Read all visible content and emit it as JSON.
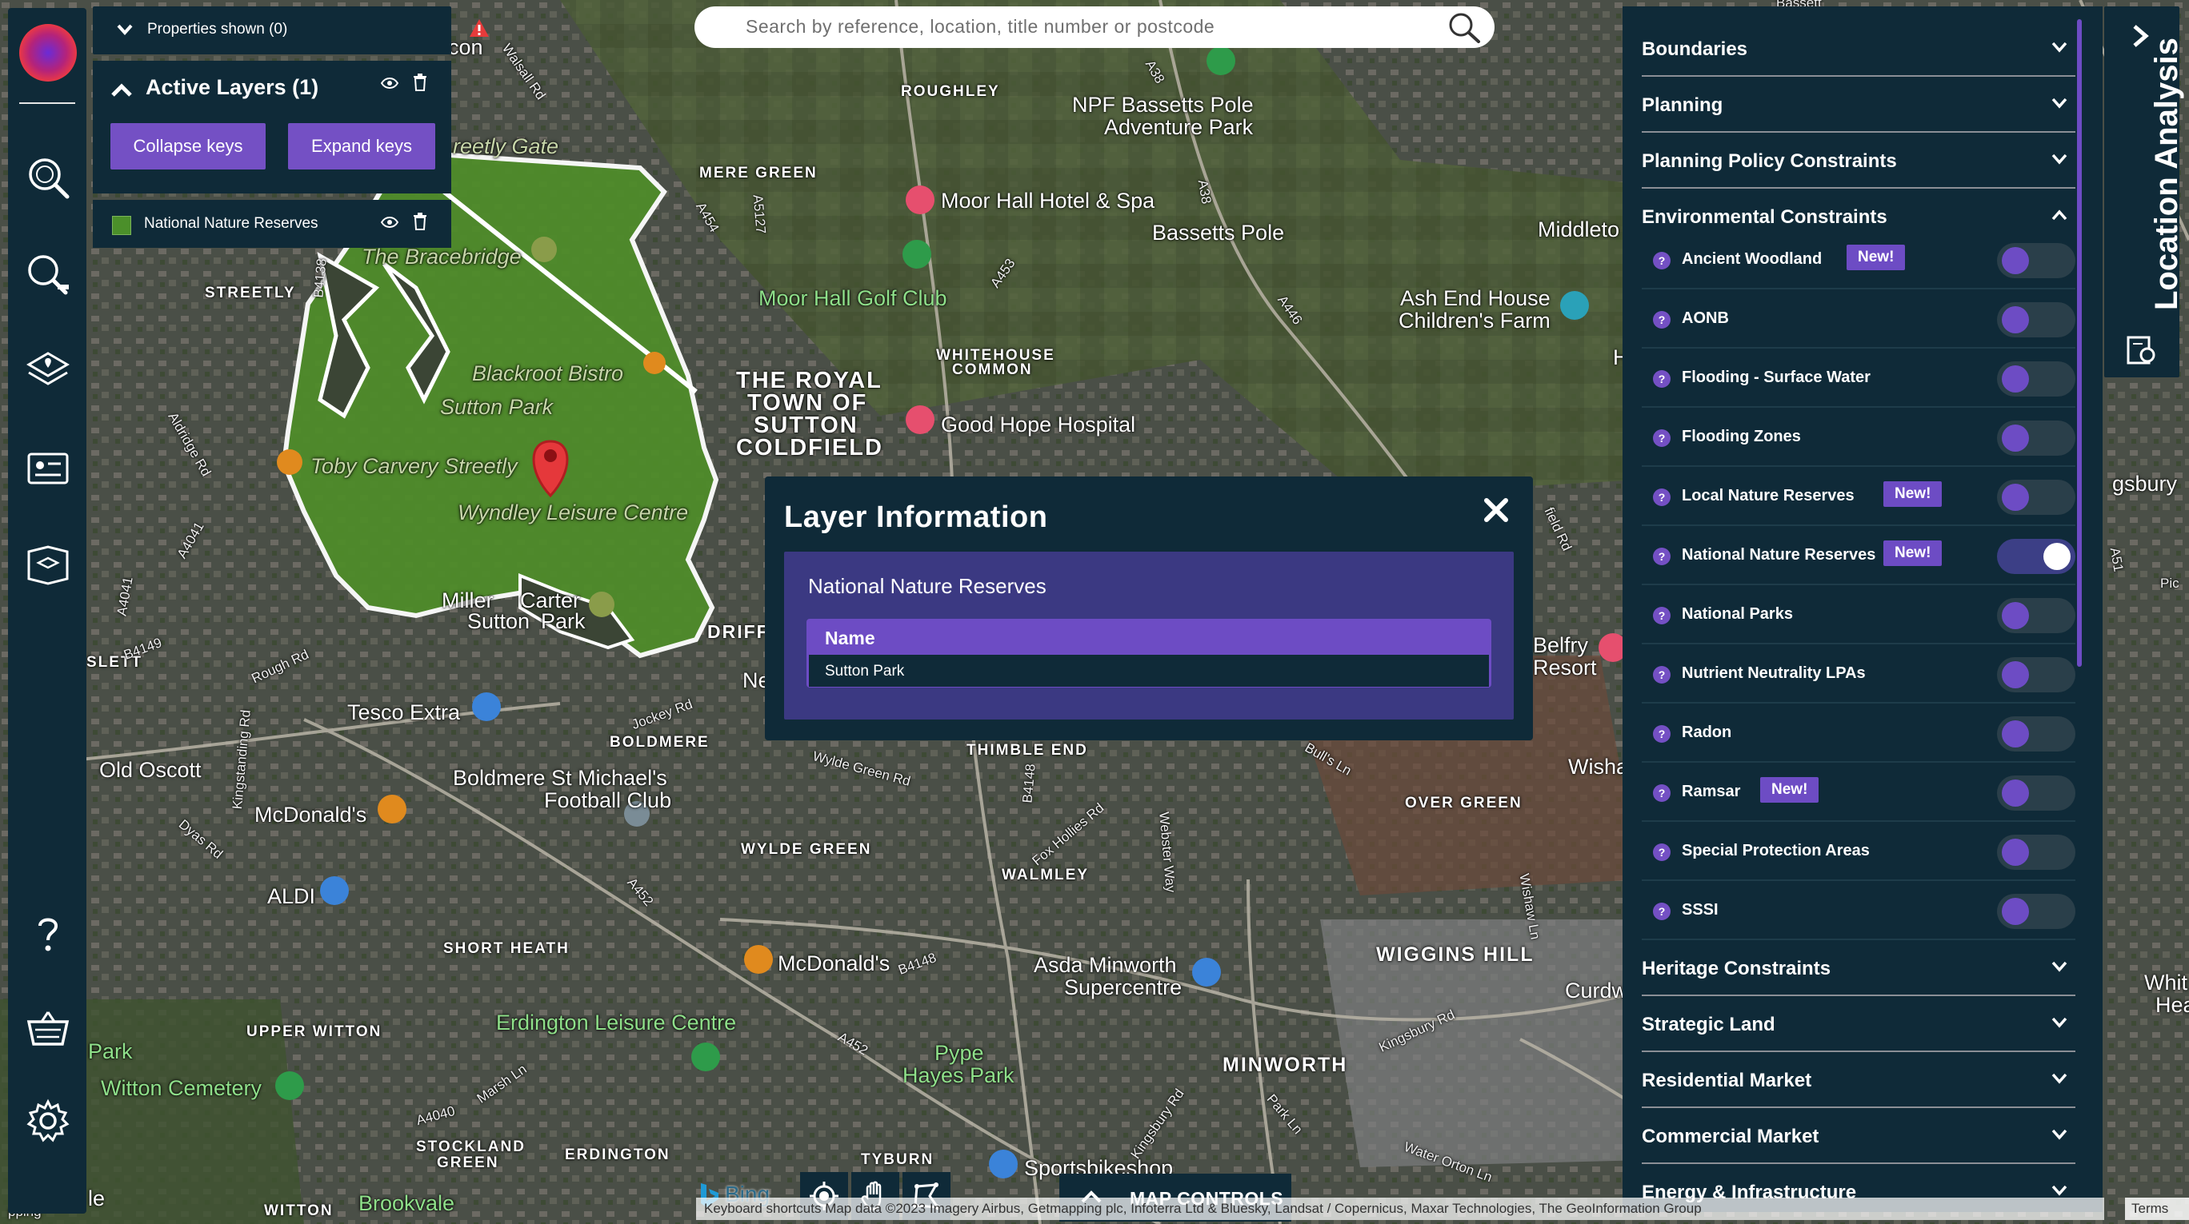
{
  "search": {
    "placeholder": "Search by reference, location, title number or postcode"
  },
  "properties": {
    "label": "Properties shown (0)"
  },
  "active_layers": {
    "title": "Active Layers (1)",
    "collapse_label": "Collapse keys",
    "expand_label": "Expand keys",
    "layer_name": "National Nature Reserves",
    "swatch_color": "#4b8f2a"
  },
  "popup": {
    "title": "Layer Information",
    "layer_name": "National Nature Reserves",
    "col_header": "Name",
    "value": "Sutton Park"
  },
  "right_panel": {
    "sections_top": [
      "Boundaries",
      "Planning",
      "Planning Policy Constraints",
      "Environmental Constraints"
    ],
    "items": [
      {
        "label": "Ancient Woodland",
        "new": true,
        "on": false
      },
      {
        "label": "AONB",
        "new": false,
        "on": false
      },
      {
        "label": "Flooding - Surface Water",
        "new": false,
        "on": false
      },
      {
        "label": "Flooding Zones",
        "new": false,
        "on": false
      },
      {
        "label": "Local Nature Reserves",
        "new": true,
        "on": false
      },
      {
        "label": "National Nature Reserves",
        "new": true,
        "on": true
      },
      {
        "label": "National Parks",
        "new": false,
        "on": false
      },
      {
        "label": "Nutrient Neutrality LPAs",
        "new": false,
        "on": false
      },
      {
        "label": "Radon",
        "new": false,
        "on": false
      },
      {
        "label": "Ramsar",
        "new": true,
        "on": false
      },
      {
        "label": "Special Protection Areas",
        "new": false,
        "on": false
      },
      {
        "label": "SSSI",
        "new": false,
        "on": false
      }
    ],
    "new_badge": "New!",
    "sections_bottom": [
      "Heritage Constraints",
      "Strategic Land",
      "Residential Market",
      "Commercial Market",
      "Energy & Infrastructure"
    ]
  },
  "location_tab": {
    "label": "Location Analysis"
  },
  "map_controls": {
    "label": "MAP CONTROLS"
  },
  "bing": {
    "label": "Bing"
  },
  "attribution": "Keyboard shortcuts  Map data ©2023 Imagery  Airbus, Getmapping plc, Infoterra Ltd & Bluesky, Landsat / Copernicus, Maxar Technologies, The GeoInformation Group",
  "terms": "Terms",
  "map_labels": {
    "roughley": "ROUGHLEY",
    "mere_green": "MERE GREEN",
    "streetly": "STREETLY",
    "slett": "SLETT",
    "boldmere": "BOLDMERE",
    "whitehouse": "WHITEHOUSE",
    "common": "COMMON",
    "royal_town": "THE ROYAL",
    "town_of": "TOWN OF",
    "sutton": "SUTTON",
    "coldfield": "COLDFIELD",
    "thimble_end": "THIMBLE END",
    "over_green": "OVER GREEN",
    "wylde_green": "WYLDE GREEN",
    "walmley": "WALMLEY",
    "wiggins_hill": "WIGGINS HILL",
    "short_heath": "SHORT HEATH",
    "upper_witton": "UPPER WITTON",
    "minworth": "MINWORTH",
    "stockland": "STOCKLAND",
    "green": "GREEN",
    "erdington": "ERDINGTON",
    "tyburn": "TYBURN",
    "witton": "WITTON",
    "driff": "DRIFF",
    "npf": "NPF Bassetts Pole",
    "adventure": "Adventure Park",
    "moor_hall_hotel": "Moor Hall Hotel & Spa",
    "bassetts_pole": "Bassetts Pole",
    "moor_hall_golf": "Moor Hall Golf Club",
    "good_hope": "Good Hope Hospital",
    "ash_end": "Ash End House",
    "childrens_farm": "Children's Farm",
    "middleton": "Middleto",
    "tesco": "Tesco Extra",
    "old_oscott": "Old Oscott",
    "mcdonalds1": "McDonald's",
    "aldi": "ALDI",
    "boldmere_st": "Boldmere St Michael's",
    "football_club": "Football Club",
    "mcdonalds2": "McDonald's",
    "asda": "Asda Minworth",
    "supercentre": "Supercentre",
    "erdington_leisure": "Erdington Leisure Centre",
    "pype": "Pype",
    "hayes_park": "Hayes Park",
    "park": "Park",
    "witton_cem": "Witton Cemetery",
    "brookvale": "Brookvale",
    "sportsbike": "Sportsbikeshop",
    "belfry": "Belfry",
    "resort": "Resort",
    "wisha": "Wisha",
    "curdw": "Curdw",
    "whit": "Whit",
    "hea": "Hea",
    "gsbury": "gsbury",
    "pic": "Pic",
    "the_bracebridge": "The Bracebridge",
    "blackroot": "Blackroot Bistro",
    "sutton_park": "Sutton Park",
    "toby": "Toby Carvery Streetly",
    "wyndley": "Wyndley Leisure Centre",
    "miller": "Miller",
    "carter": "Carter",
    "sutton2": "Sutton",
    "park2": "Park",
    "streetly_gate": "reetly Gate",
    "con": "con",
    "ne": "Ne",
    "h": "H",
    "le": "le",
    "opping": "pping",
    "bassett": "Bassett",
    "r_walsall": "Walsall Rd",
    "r_a38": "A38",
    "r_a454": "A454",
    "r_a5127": "A5127",
    "r_a453": "A453",
    "r_a446": "A446",
    "r_b4138": "B4138",
    "r_aldridge": "Aldridge Rd",
    "r_a4041": "A4041",
    "r_b4149": "B4149",
    "r_rough": "Rough Rd",
    "r_jockey": "Jockey Rd",
    "r_kingstanding": "Kingstanding Rd",
    "r_dyas": "Dyas Rd",
    "r_a452": "A452",
    "r_wyde": "Wylde Green Rd",
    "r_b4148": "B4148",
    "r_fox": "Fox Hollies Rd",
    "r_webster": "Webster Way",
    "r_bulls": "Bull's Ln",
    "r_wishaw": "Wishaw Ln",
    "r_kingsbury": "Kingsbury Rd",
    "r_park_ln": "Park Ln",
    "r_water": "Water Orton Ln",
    "r_marsh": "Marsh Ln",
    "r_a4040": "A4040",
    "r_a51": "A51",
    "r_field": "field Rd"
  }
}
